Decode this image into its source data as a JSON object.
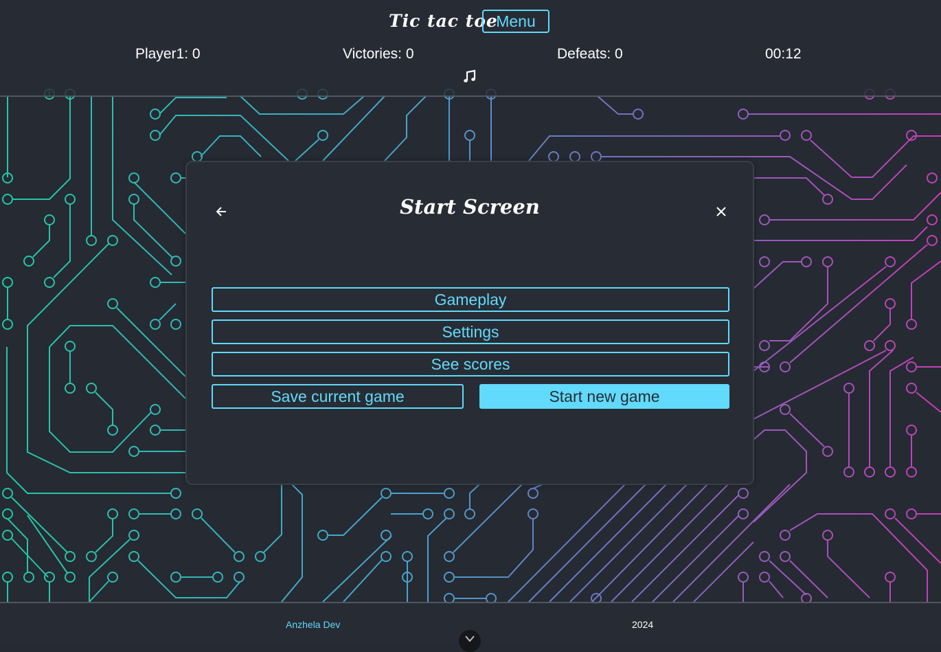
{
  "header": {
    "app_title": "Tic tac toe",
    "menu_label": "Menu",
    "player_score": "Player1: 0",
    "victories": "Victories: 0",
    "defeats": "Defeats: 0",
    "timer": "00:12",
    "music_icon": "music-note-icon"
  },
  "modal": {
    "title": "Start Screen",
    "back_icon": "arrow-left-icon",
    "close_icon": "close-icon",
    "buttons": {
      "gameplay": "Gameplay",
      "settings": "Settings",
      "scores": "See scores",
      "save": "Save current game",
      "new_game": "Start new game"
    }
  },
  "footer": {
    "author": "Anzhela Dev",
    "year": "2024",
    "scroll_icon": "chevron-down-icon"
  },
  "colors": {
    "accent": "#61dafb",
    "background": "#282c34",
    "circuit_start": "#20c9a6",
    "circuit_mid": "#5a8fc4",
    "circuit_end": "#c43fb5"
  }
}
